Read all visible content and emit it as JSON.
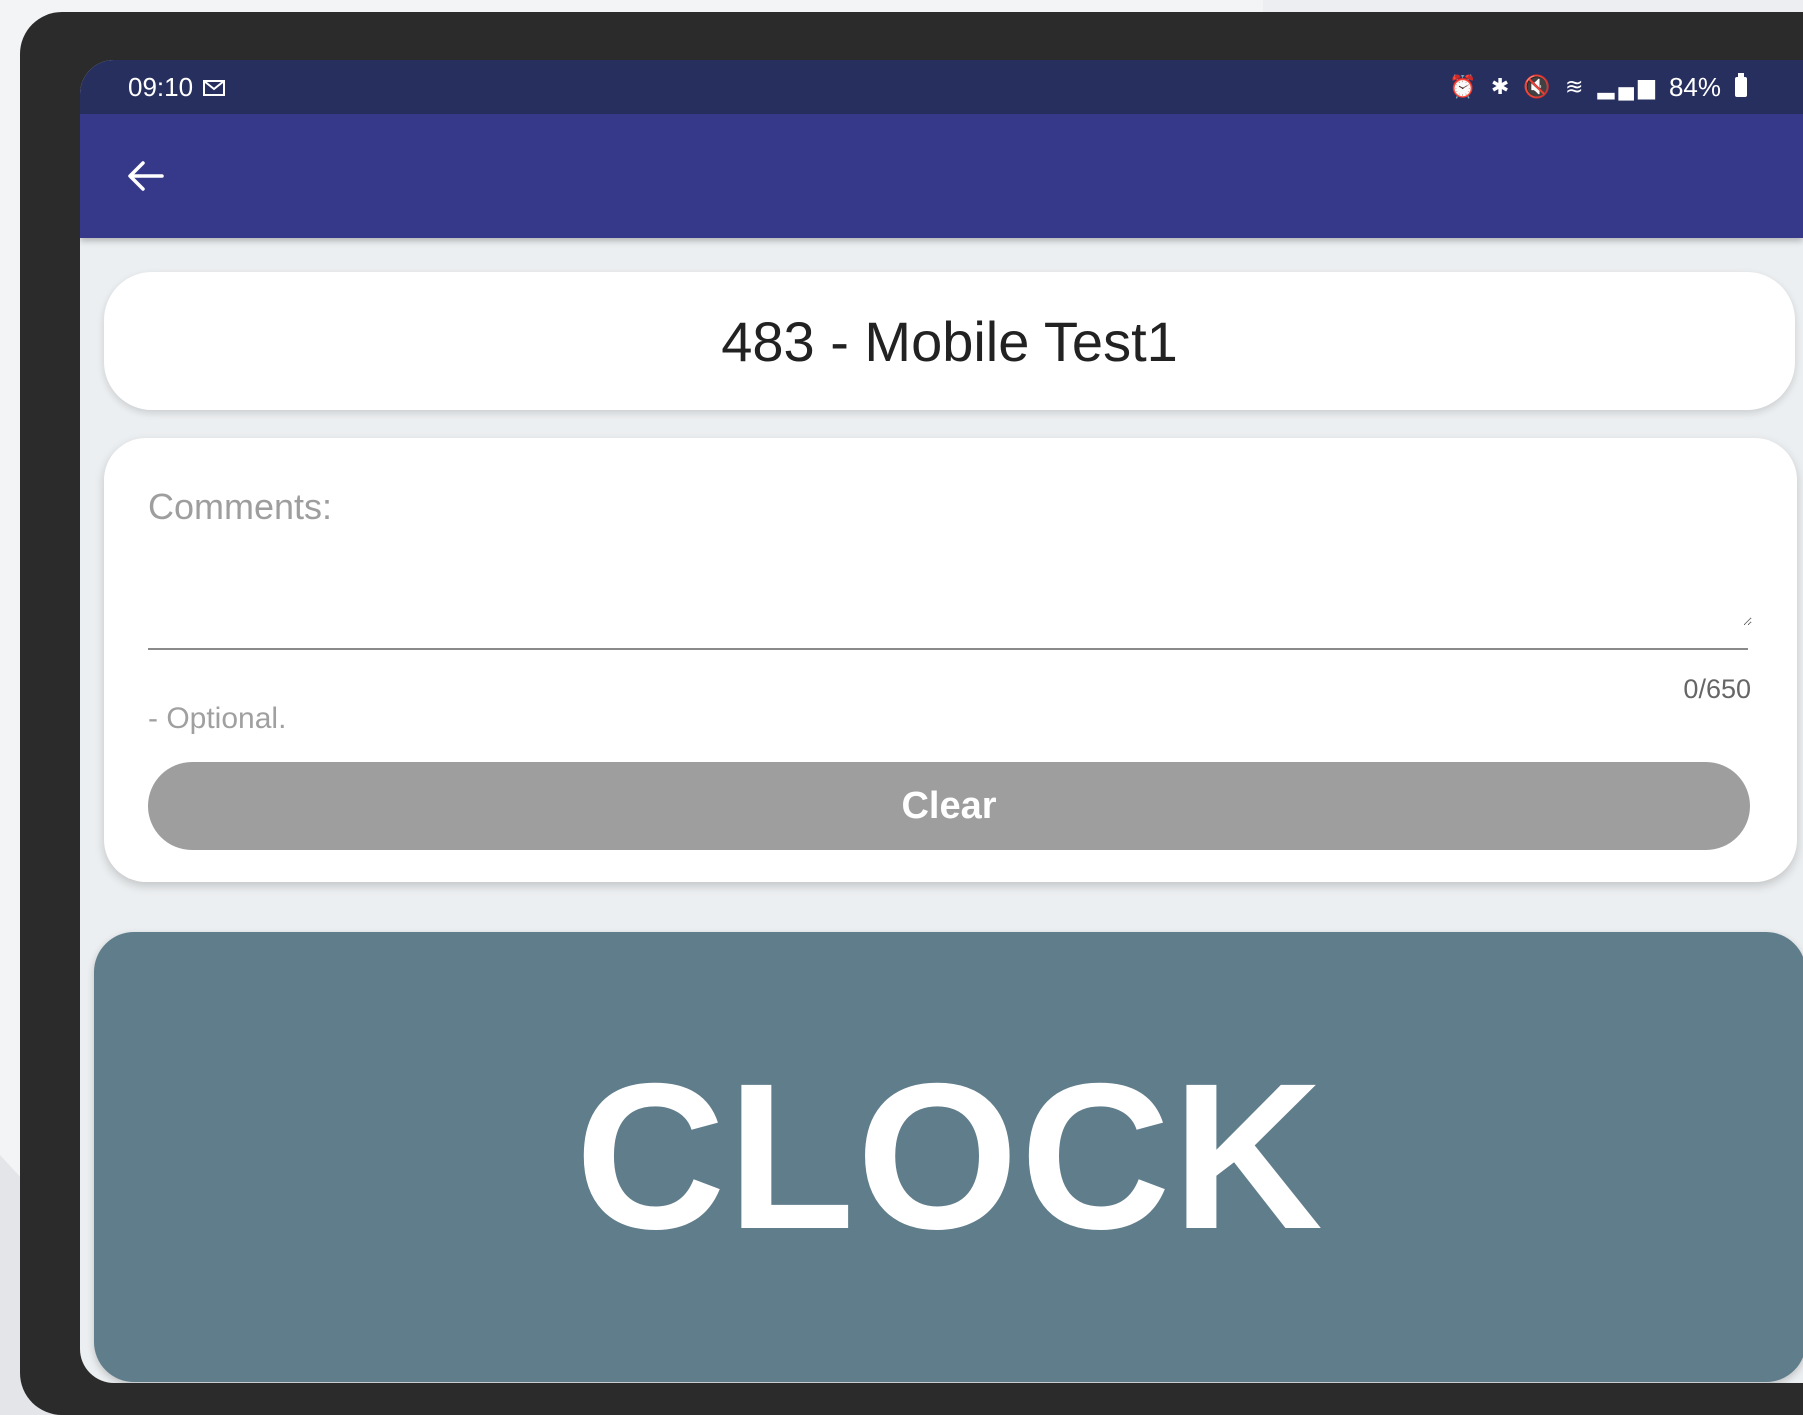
{
  "status_bar": {
    "time": "09:10",
    "left_icons": [
      "mail-icon"
    ],
    "right_icons": [
      "alarm-icon",
      "bluetooth-icon",
      "mute-icon",
      "wifi-icon",
      "volte-icon",
      "signal-icon"
    ],
    "battery_text": "84%"
  },
  "app_bar": {
    "back_icon": "arrow-left-icon",
    "back_glyph": "←",
    "background_color": "#36398a"
  },
  "header": {
    "title": "483 - Mobile Test1"
  },
  "comments": {
    "label": "Comments:",
    "value": "",
    "char_count": "0/650",
    "helper": "- Optional.",
    "clear_label": "Clear"
  },
  "clock_button": {
    "label": "CLOCK",
    "color": "#607d8b"
  }
}
